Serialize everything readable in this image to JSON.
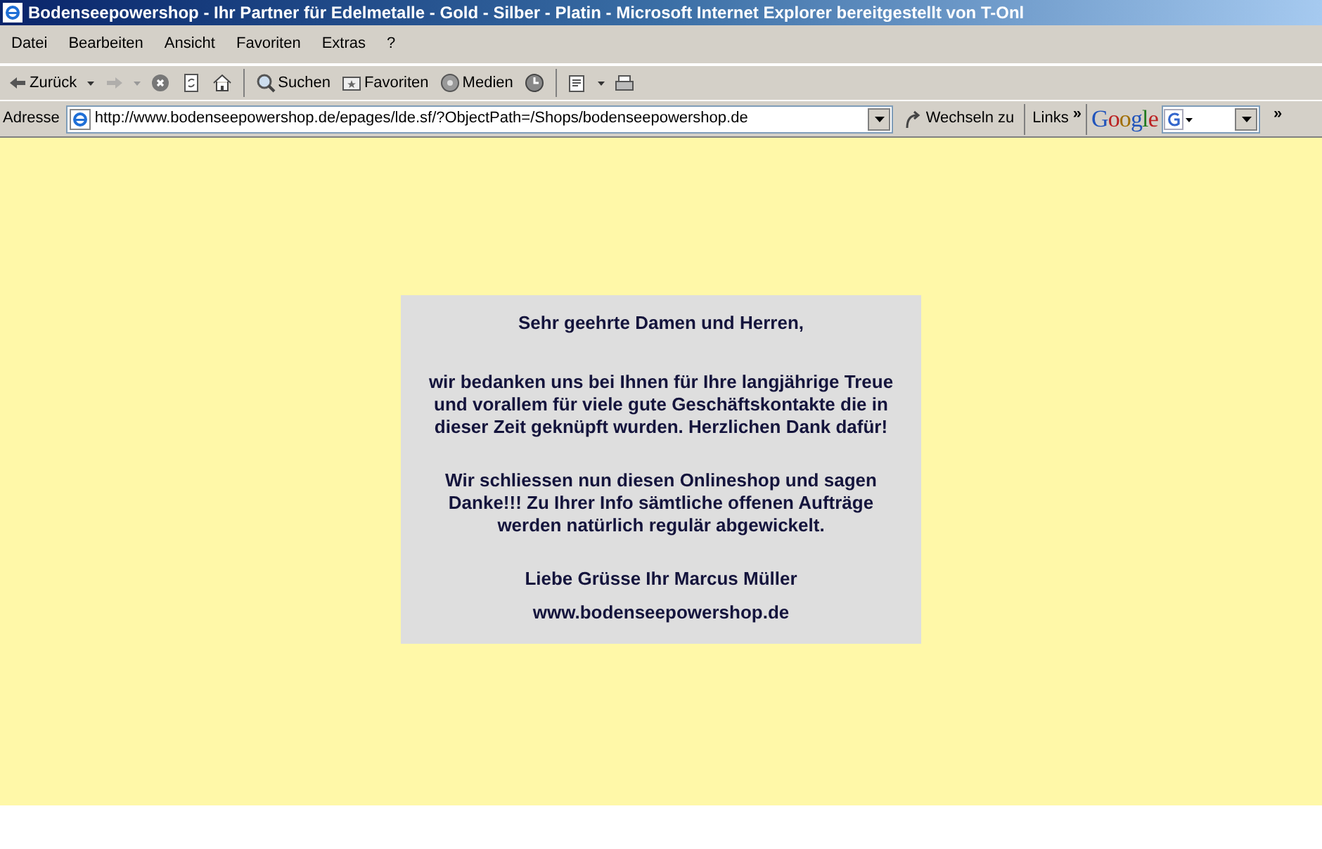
{
  "window": {
    "title": "Bodenseepowershop - Ihr Partner für Edelmetalle - Gold - Silber - Platin - Microsoft Internet Explorer bereitgestellt von T-Onl"
  },
  "menu": [
    "Datei",
    "Bearbeiten",
    "Ansicht",
    "Favoriten",
    "Extras",
    "?"
  ],
  "toolbar": [
    {
      "kind": "back",
      "label": "Zurück",
      "disabled": false,
      "dropdown": true
    },
    {
      "kind": "forward",
      "disabled": true,
      "dropdown": true
    },
    {
      "kind": "stop",
      "disabled": false
    },
    {
      "kind": "refresh",
      "disabled": false
    },
    {
      "kind": "home",
      "disabled": false
    },
    {
      "kind": "search",
      "label": "Suchen",
      "disabled": false
    },
    {
      "kind": "favorites",
      "label": "Favoriten",
      "disabled": false
    },
    {
      "kind": "media",
      "label": "Medien",
      "disabled": false
    },
    {
      "kind": "history",
      "disabled": false
    },
    {
      "kind": "mail",
      "disabled": false,
      "dropdown": true
    },
    {
      "kind": "print",
      "disabled": false
    }
  ],
  "address_bar": {
    "label": "Adresse",
    "value": "http://www.bodenseepowershop.de/epages/lde.sf/?ObjectPath=/Shops/bodenseepowershop.de",
    "go": "Wechseln zu",
    "links": "Links",
    "links_more": "»",
    "google": "Google",
    "google_more": "»"
  },
  "message": {
    "greeting": "Sehr geehrte Damen und Herren,",
    "paragraphs": [
      "wir bedanken uns bei Ihnen für Ihre langjährige Treue und vorallem für viele gute Geschäftskontakte die in dieser Zeit geknüpft wurden. Herzlichen Dank dafür!",
      "Wir schliessen nun diesen Onlineshop und sagen Danke!!! Zu Ihrer Info sämtliche offenen Aufträge werden natürlich regulär abgewickelt."
    ],
    "signature": "Liebe Grüsse Ihr Marcus Müller",
    "website": "www.bodenseepowershop.de"
  }
}
